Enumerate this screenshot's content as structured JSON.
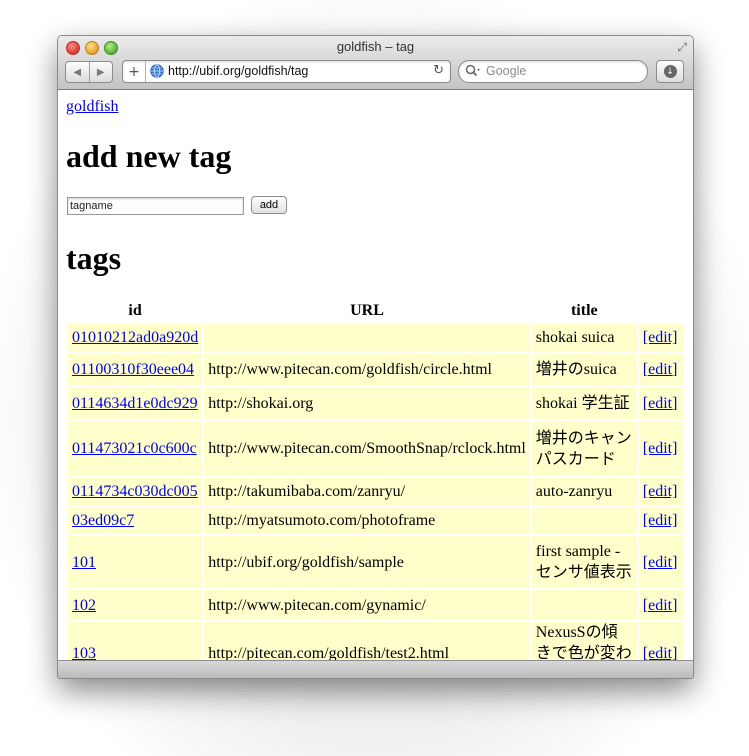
{
  "window": {
    "title": "goldfish – tag"
  },
  "toolbar": {
    "back_icon": "back-arrow-icon",
    "forward_icon": "forward-arrow-icon",
    "plus_label": "+",
    "url": "http://ubif.org/goldfish/tag",
    "search_placeholder": "Google"
  },
  "page": {
    "home_link": "goldfish",
    "add_heading": "add new tag",
    "input_value": "tagname",
    "add_button": "add",
    "tags_heading": "tags",
    "columns": [
      "id",
      "URL",
      "title",
      ""
    ],
    "edit_label": "[edit]",
    "rows": [
      {
        "id": "01010212ad0a920d",
        "url": "",
        "title": "shokai suica"
      },
      {
        "id": "01100310f30eee04",
        "url": "http://www.pitecan.com/goldfish/circle.html",
        "title": "増井のsuica"
      },
      {
        "id": "0114634d1e0dc929",
        "url": "http://shokai.org",
        "title": "shokai 学生証"
      },
      {
        "id": "011473021c0c600c",
        "url": "http://www.pitecan.com/SmoothSnap/rclock.html",
        "title": "増井のキャンパスカード"
      },
      {
        "id": "0114734c030dc005",
        "url": "http://takumibaba.com/zanryu/",
        "title": "auto-zanryu"
      },
      {
        "id": "03ed09c7",
        "url": "http://myatsumoto.com/photoframe",
        "title": ""
      },
      {
        "id": "101",
        "url": "http://ubif.org/goldfish/sample",
        "title": "first sample - センサ値表示"
      },
      {
        "id": "102",
        "url": "http://www.pitecan.com/gynamic/",
        "title": ""
      },
      {
        "id": "103",
        "url": "http://pitecan.com/goldfish/test2.html",
        "title": "NexusSの傾きで色が変わる"
      }
    ]
  }
}
